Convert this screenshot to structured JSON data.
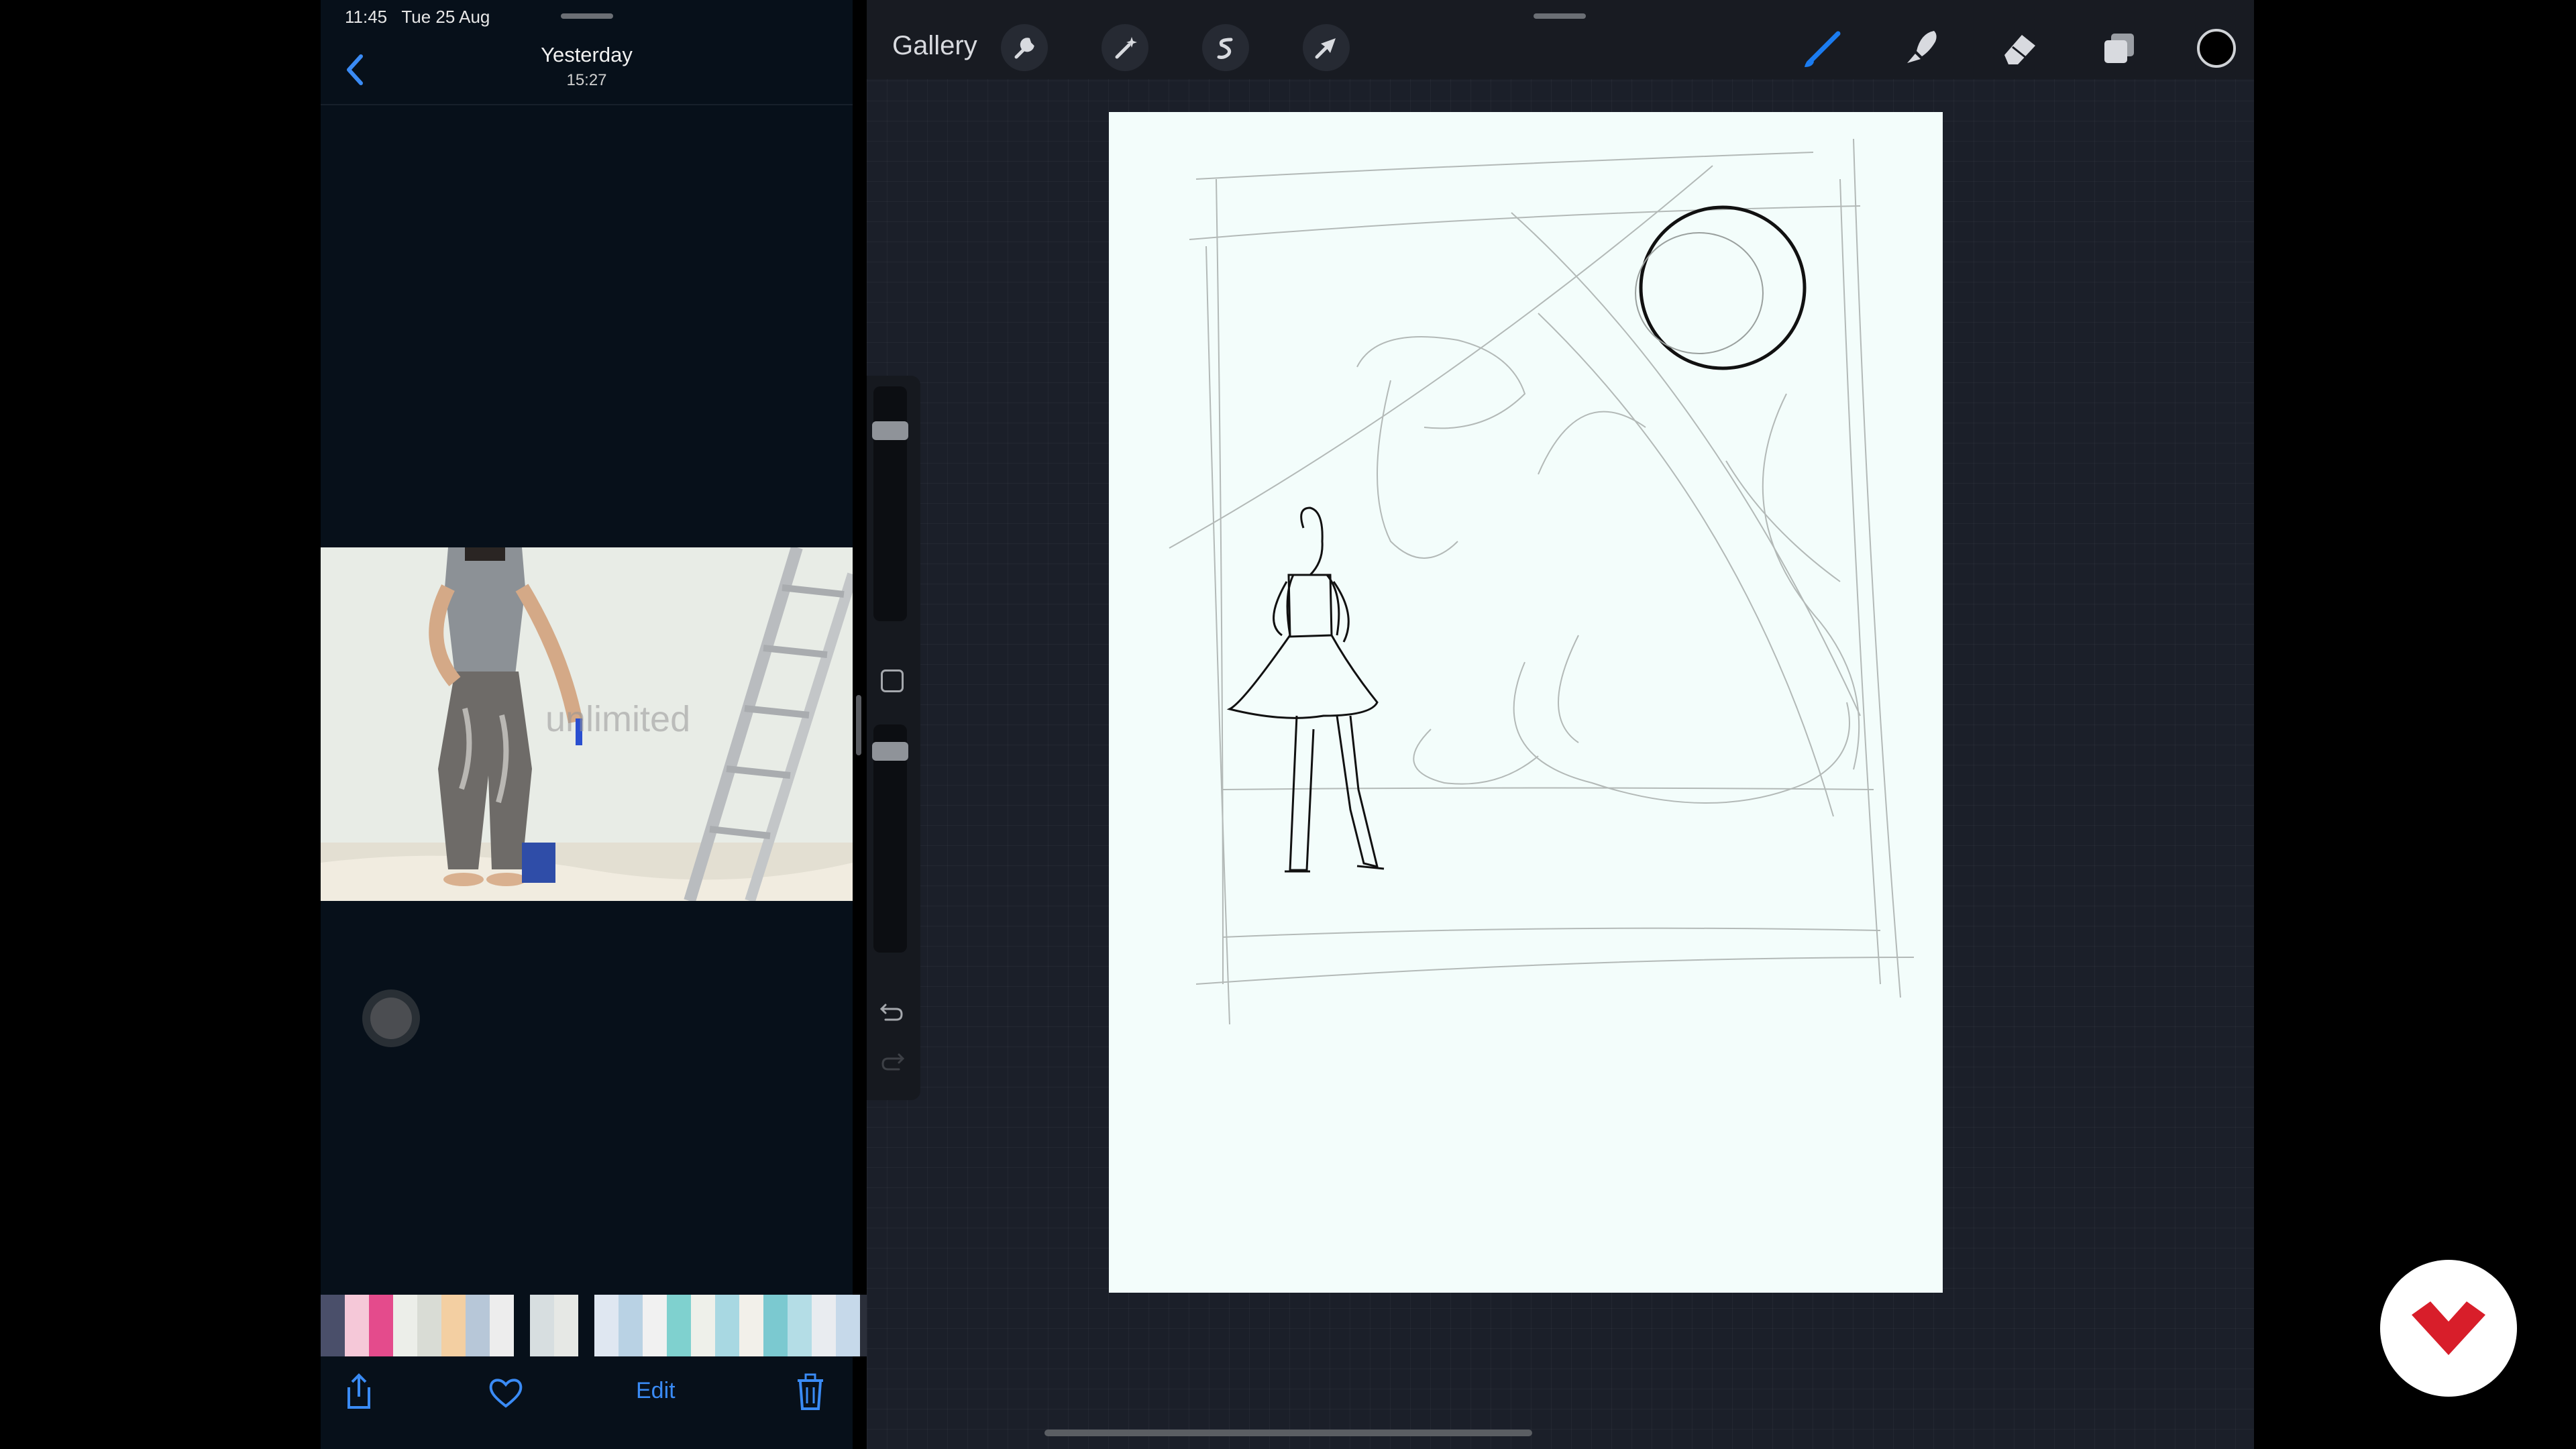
{
  "photos": {
    "status_bar": {
      "time": "11:45",
      "date": "Tue 25 Aug"
    },
    "header": {
      "title": "Yesterday",
      "subtitle": "15:27",
      "back_icon": "chevron-left-icon"
    },
    "photo": {
      "watermark": "unlimited"
    },
    "toolbar": {
      "share_icon": "share-icon",
      "favorite_icon": "heart-icon",
      "edit_label": "Edit",
      "delete_icon": "trash-icon",
      "accent_color": "#3a8bf5"
    },
    "thumbnails": [
      "#4a4f6a",
      "#f5c8d8",
      "#e44b8c",
      "#eceee9",
      "#d9dcd5",
      "#f3cfa2",
      "#b7c7d8",
      "#ededed",
      "#d7dee0",
      "#e6e8e5",
      "#dfe7f1",
      "#b9d2e4",
      "#f1f1f1",
      "#7fd1cf",
      "#eef0ea",
      "#a8d8e2",
      "#f2f0ea",
      "#7bc9d0",
      "#b4dde6",
      "#e9ecf0",
      "#c6d9ea",
      "#2b2f3a"
    ]
  },
  "procreate": {
    "gallery_label": "Gallery",
    "left_tools": [
      "wrench-icon",
      "magic-wand-icon",
      "selection-icon",
      "transform-arrow-icon"
    ],
    "right_tools": [
      "brush-icon",
      "smudge-icon",
      "eraser-icon",
      "layers-icon",
      "color-swatch-icon"
    ],
    "accent_color": "#1b7cf0",
    "current_color": "#000000",
    "sidebar": [
      "brush-size-slider",
      "modify-square-button",
      "opacity-slider",
      "undo-icon",
      "redo-icon"
    ]
  },
  "logo": {
    "name": "brand-logo-icon",
    "color": "#d81e2a"
  }
}
